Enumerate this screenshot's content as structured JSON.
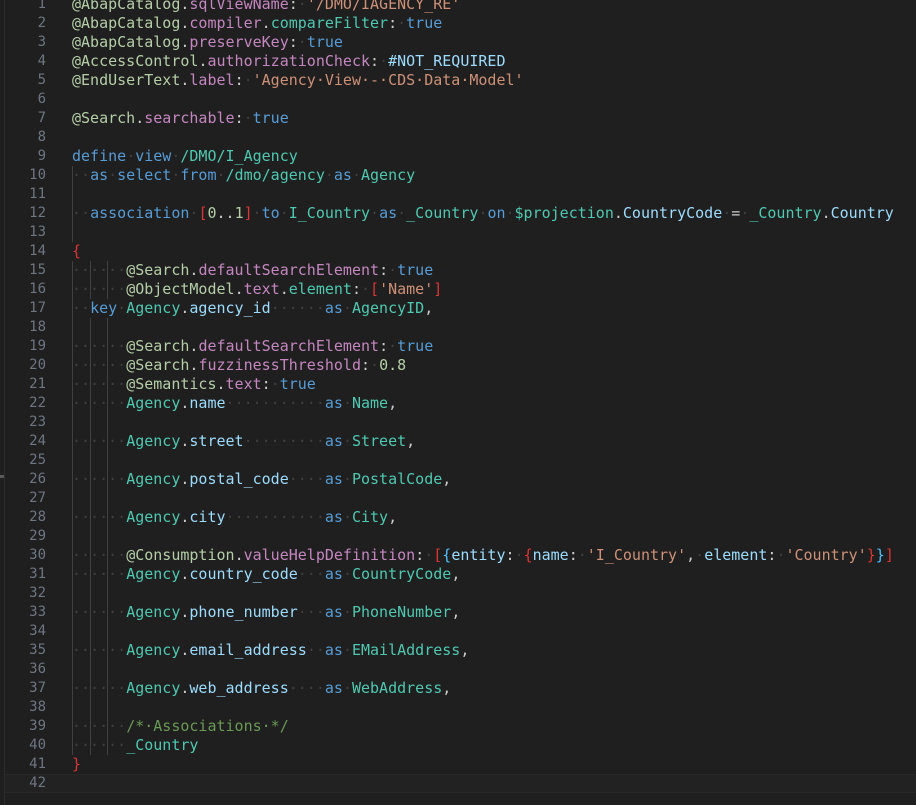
{
  "editor": {
    "kind": "code-editor",
    "language": "CDS / ABAP Core Data Services",
    "theme": "dark-plus",
    "colors": {
      "background": "#1f1f1f",
      "line_number": "#6e7681",
      "active_line_background": "#222222",
      "active_line_border": "#282828",
      "indent_guide": "#404040",
      "whitespace_dot": "#3f3f3f",
      "annotation": "#b5cea8",
      "annotation_key": "#c586c0",
      "annotation_sub": "#4ec9b0",
      "keyword": "#569cd6",
      "string": "#ce9178",
      "number": "#b5cea8",
      "entity": "#4ec9b0",
      "field": "#9cdcfe",
      "comment": "#6a9955",
      "bracket_level_1": "#da3633",
      "bracket_level_2": "#4fc1ff",
      "default_text": "#cccccc"
    },
    "first_line_number": 1,
    "last_line_number": 42,
    "active_line_number": 42,
    "total_lines": 42
  },
  "source_text": "@AbapCatalog.sqlViewName: '/DMO/IAGENCY_RE'\n@AbapCatalog.compiler.compareFilter: true\n@AbapCatalog.preserveKey: true\n@AccessControl.authorizationCheck: #NOT_REQUIRED\n@EndUserText.label: 'Agency View - CDS Data Model'\n\n@Search.searchable: true\n\ndefine view /DMO/I_Agency\n  as select from /dmo/agency as Agency\n\n  association [0..1] to I_Country as _Country on $projection.CountryCode = _Country.Country\n\n{\n      @Search.defaultSearchElement: true\n      @ObjectModel.text.element: ['Name']\n  key Agency.agency_id      as AgencyID,\n\n      @Search.defaultSearchElement: true\n      @Search.fuzzinessThreshold: 0.8\n      @Semantics.text: true\n      Agency.name           as Name,\n\n      Agency.street         as Street,\n\n      Agency.postal_code    as PostalCode,\n\n      Agency.city           as City,\n\n      @Consumption.valueHelpDefinition: [{entity: {name: 'I_Country', element: 'Country'}}]\n      Agency.country_code   as CountryCode,\n\n      Agency.phone_number   as PhoneNumber,\n\n      Agency.email_address  as EMailAddress,\n\n      Agency.web_address    as WebAddress,\n\n      /* Associations */\n      _Country\n}\n",
  "lines": [
    {
      "n": 1,
      "text": "@AbapCatalog.sqlViewName: '/DMO/IAGENCY_RE'"
    },
    {
      "n": 2,
      "text": "@AbapCatalog.compiler.compareFilter: true"
    },
    {
      "n": 3,
      "text": "@AbapCatalog.preserveKey: true"
    },
    {
      "n": 4,
      "text": "@AccessControl.authorizationCheck: #NOT_REQUIRED"
    },
    {
      "n": 5,
      "text": "@EndUserText.label: 'Agency View - CDS Data Model'"
    },
    {
      "n": 6,
      "text": ""
    },
    {
      "n": 7,
      "text": "@Search.searchable: true"
    },
    {
      "n": 8,
      "text": ""
    },
    {
      "n": 9,
      "text": "define view /DMO/I_Agency"
    },
    {
      "n": 10,
      "text": "  as select from /dmo/agency as Agency"
    },
    {
      "n": 11,
      "text": ""
    },
    {
      "n": 12,
      "text": "  association [0..1] to I_Country as _Country on $projection.CountryCode = _Country.Country"
    },
    {
      "n": 13,
      "text": ""
    },
    {
      "n": 14,
      "text": "{"
    },
    {
      "n": 15,
      "text": "      @Search.defaultSearchElement: true"
    },
    {
      "n": 16,
      "text": "      @ObjectModel.text.element: ['Name']"
    },
    {
      "n": 17,
      "text": "  key Agency.agency_id      as AgencyID,"
    },
    {
      "n": 18,
      "text": ""
    },
    {
      "n": 19,
      "text": "      @Search.defaultSearchElement: true"
    },
    {
      "n": 20,
      "text": "      @Search.fuzzinessThreshold: 0.8"
    },
    {
      "n": 21,
      "text": "      @Semantics.text: true"
    },
    {
      "n": 22,
      "text": "      Agency.name           as Name,"
    },
    {
      "n": 23,
      "text": ""
    },
    {
      "n": 24,
      "text": "      Agency.street         as Street,"
    },
    {
      "n": 25,
      "text": ""
    },
    {
      "n": 26,
      "text": "      Agency.postal_code    as PostalCode,"
    },
    {
      "n": 27,
      "text": ""
    },
    {
      "n": 28,
      "text": "      Agency.city           as City,"
    },
    {
      "n": 29,
      "text": ""
    },
    {
      "n": 30,
      "text": "      @Consumption.valueHelpDefinition: [{entity: {name: 'I_Country', element: 'Country'}}]"
    },
    {
      "n": 31,
      "text": "      Agency.country_code   as CountryCode,"
    },
    {
      "n": 32,
      "text": ""
    },
    {
      "n": 33,
      "text": "      Agency.phone_number   as PhoneNumber,"
    },
    {
      "n": 34,
      "text": ""
    },
    {
      "n": 35,
      "text": "      Agency.email_address  as EMailAddress,"
    },
    {
      "n": 36,
      "text": ""
    },
    {
      "n": 37,
      "text": "      Agency.web_address    as WebAddress,"
    },
    {
      "n": 38,
      "text": ""
    },
    {
      "n": 39,
      "text": "      /* Associations */"
    },
    {
      "n": 40,
      "text": "      _Country"
    },
    {
      "n": 41,
      "text": "}"
    },
    {
      "n": 42,
      "text": ""
    }
  ],
  "cds_model": {
    "view_name": "/DMO/I_Agency",
    "sql_view_name": "/DMO/IAGENCY_RE",
    "data_source": "/dmo/agency",
    "data_source_alias": "Agency",
    "label": "Agency View - CDS Data Model",
    "authorization_check": "#NOT_REQUIRED",
    "compare_filter": "true",
    "preserve_key": "true",
    "searchable": "true",
    "associations": [
      {
        "cardinality": "[0..1]",
        "target": "I_Country",
        "alias": "_Country",
        "on_condition": "$projection.CountryCode = _Country.Country"
      }
    ],
    "fields": [
      {
        "key": true,
        "source": "Agency.agency_id",
        "alias": "AgencyID"
      },
      {
        "key": false,
        "source": "Agency.name",
        "alias": "Name"
      },
      {
        "key": false,
        "source": "Agency.street",
        "alias": "Street"
      },
      {
        "key": false,
        "source": "Agency.postal_code",
        "alias": "PostalCode"
      },
      {
        "key": false,
        "source": "Agency.city",
        "alias": "City"
      },
      {
        "key": false,
        "source": "Agency.country_code",
        "alias": "CountryCode"
      },
      {
        "key": false,
        "source": "Agency.phone_number",
        "alias": "PhoneNumber"
      },
      {
        "key": false,
        "source": "Agency.email_address",
        "alias": "EMailAddress"
      },
      {
        "key": false,
        "source": "Agency.web_address",
        "alias": "WebAddress"
      }
    ],
    "exposed_associations": [
      "_Country"
    ],
    "comment": "/* Associations */"
  }
}
